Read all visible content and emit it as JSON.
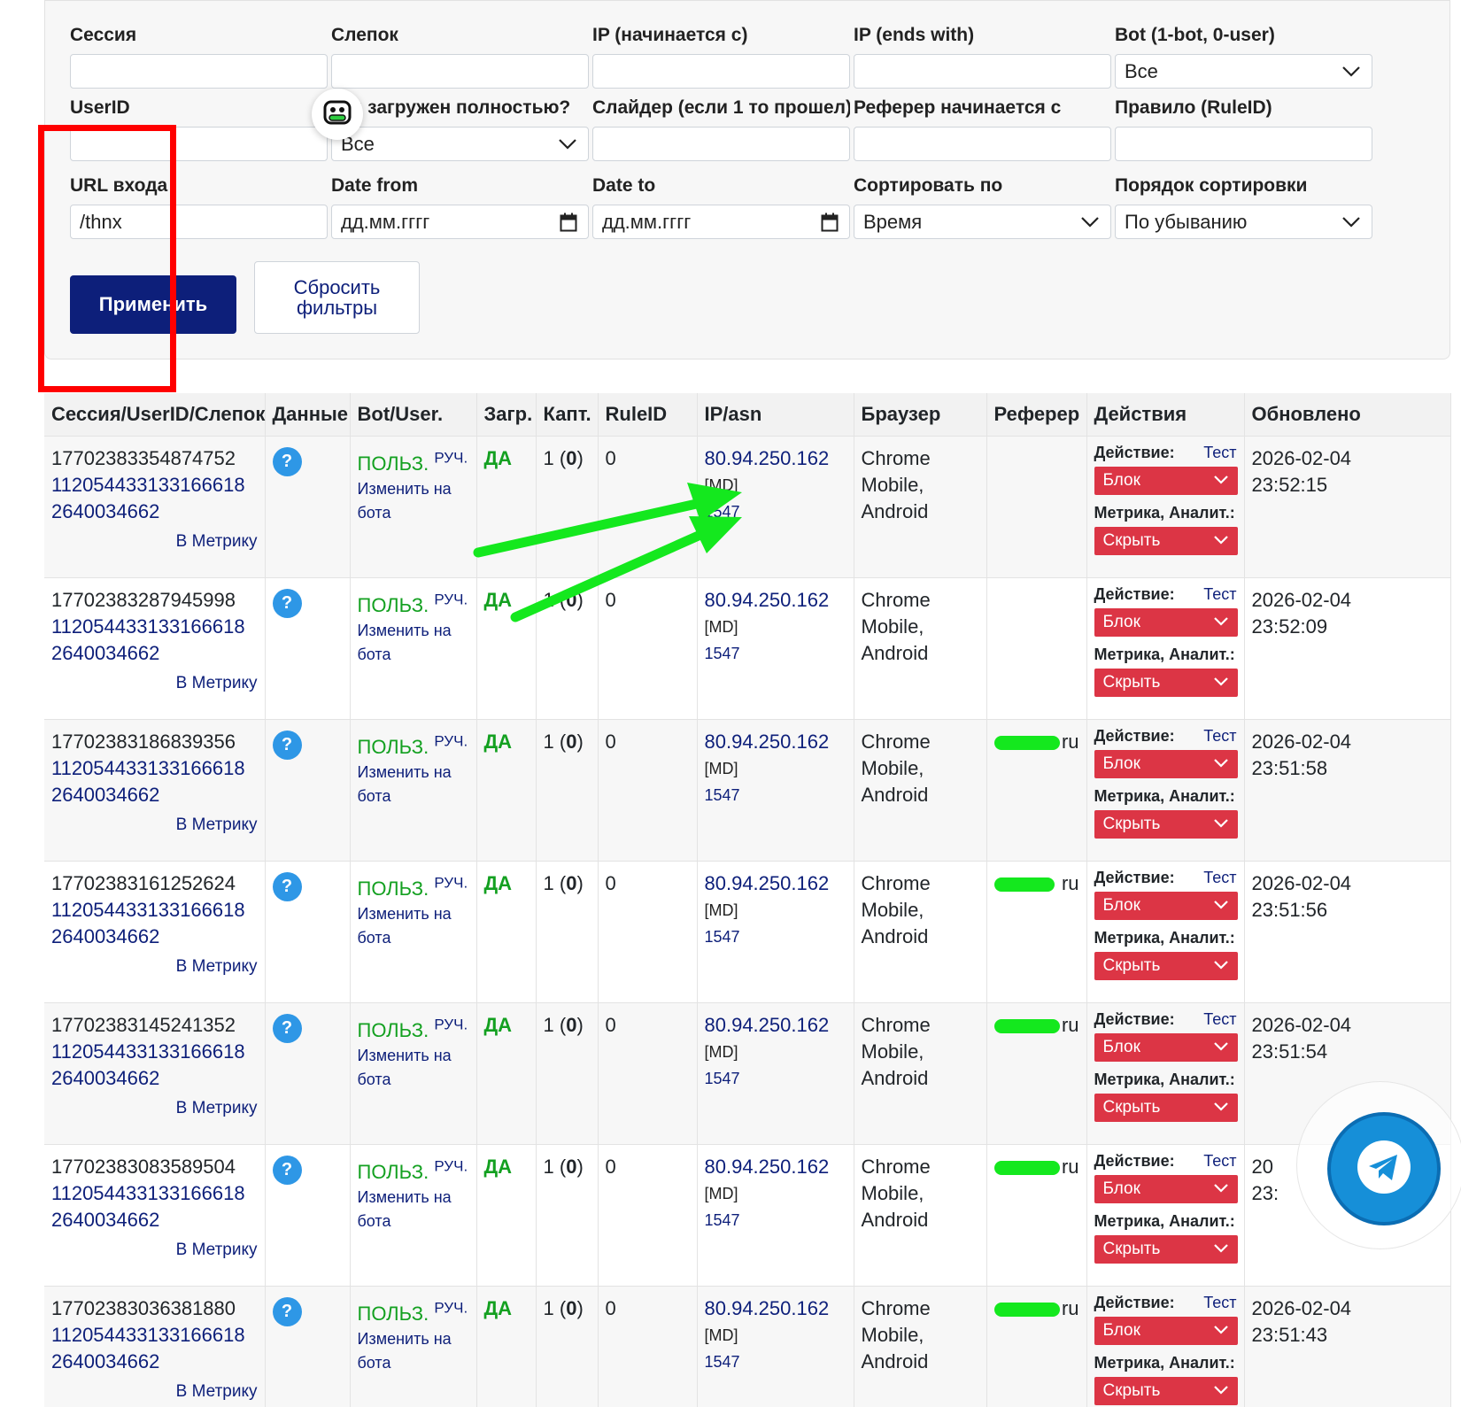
{
  "filters": {
    "session": {
      "label": "Сессия",
      "value": ""
    },
    "fingerprint": {
      "label": "Слепок",
      "value": ""
    },
    "ip_starts": {
      "label": "IP (начинается с)",
      "value": ""
    },
    "ip_ends": {
      "label": "IP (ends with)",
      "value": ""
    },
    "bot": {
      "label": "Bot (1-bot, 0-user)",
      "value": "Все"
    },
    "userid": {
      "label": "UserID",
      "value": ""
    },
    "loaded": {
      "label": "д загружен полностью?",
      "value": "Все"
    },
    "slider": {
      "label": "Слайдер (если 1 то прошел)",
      "value": ""
    },
    "referer": {
      "label": "Реферер начинается с",
      "value": ""
    },
    "rule": {
      "label": "Правило (RuleID)",
      "value": ""
    },
    "url": {
      "label": "URL входа",
      "value": "/thnx"
    },
    "date_from": {
      "label": "Date from",
      "value": "дд.мм.гггг"
    },
    "date_to": {
      "label": "Date to",
      "value": "дд.мм.гггг"
    },
    "sort_by": {
      "label": "Сортировать по",
      "value": "Время"
    },
    "sort_order": {
      "label": "Порядок сортировки",
      "value": "По убыванию"
    },
    "apply_label": "Применить",
    "reset_label": "Сбросить фильтры"
  },
  "table": {
    "headers": [
      "Сессия/UserID/Слепок",
      "Данные",
      "Bot/User.",
      "Загр.",
      "Капт.",
      "RuleID",
      "IP/asn",
      "Браузер",
      "Реферер",
      "Действия",
      "Обновлено"
    ],
    "common": {
      "metrika": "В Метрику",
      "help": "?",
      "user_label": "ПОЛЬЗ.",
      "manual": "РУЧ.",
      "change_line1": "Изменить на",
      "change_line2": "бота",
      "loaded": "ДА",
      "captcha_count": "1 (",
      "captcha_bold": "0",
      "captcha_close": ")",
      "rule_id": "0",
      "ip": "80.94.250.162",
      "country": "[MD]",
      "asn": "1547",
      "browser": "Chrome Mobile, Android",
      "action_label": "Действие:",
      "test_label": "Тест",
      "action_value": "Блок",
      "metrika_label": "Метрика, Аналит.:",
      "metrika_value": "Скрыть"
    },
    "rows": [
      {
        "session": "17702383354874752",
        "userid": "112054433133166618",
        "fp": "2640034662",
        "referer": "",
        "date": "2026-02-04",
        "time": "23:52:15"
      },
      {
        "session": "17702383287945998",
        "userid": "112054433133166618",
        "fp": "2640034662",
        "referer": "",
        "date": "2026-02-04",
        "time": "23:52:09"
      },
      {
        "session": "17702383186839356",
        "userid": "112054433133166618",
        "fp": "2640034662",
        "referer": "ru",
        "date": "2026-02-04",
        "time": "23:51:58"
      },
      {
        "session": "17702383161252624",
        "userid": "112054433133166618",
        "fp": "2640034662",
        "referer": "ru",
        "date": "2026-02-04",
        "time": "23:51:56"
      },
      {
        "session": "17702383145241352",
        "userid": "112054433133166618",
        "fp": "2640034662",
        "referer": "ru",
        "date": "2026-02-04",
        "time": "23:51:54"
      },
      {
        "session": "17702383083589504",
        "userid": "112054433133166618",
        "fp": "2640034662",
        "referer": "ru",
        "date": "20",
        "time": "23:"
      },
      {
        "session": "17702383036381880",
        "userid": "112054433133166618",
        "fp": "2640034662",
        "referer": "ru",
        "date": "2026-02-04",
        "time": "23:51:43"
      }
    ]
  },
  "colors": {
    "primary": "#0d1f7a",
    "success": "#13a020",
    "danger": "#dc3545",
    "help": "#2e97e6",
    "annotation_red": "#ff0000",
    "annotation_green": "#14e81e",
    "telegram": "#168fd8"
  },
  "icons": [
    "chevron-down-icon",
    "calendar-icon",
    "question-icon",
    "robot-icon",
    "telegram-icon"
  ]
}
